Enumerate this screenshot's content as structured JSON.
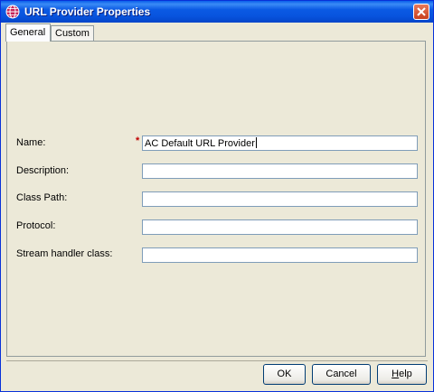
{
  "window": {
    "title": "URL Provider Properties",
    "icon": "globe-icon",
    "close_icon": "close-icon"
  },
  "tabs": [
    {
      "label": "General",
      "active": true
    },
    {
      "label": "Custom",
      "active": false
    }
  ],
  "form": {
    "name_label": "Name:",
    "name_required": "*",
    "name_value": "AC Default URL Provider",
    "description_label": "Description:",
    "description_value": "",
    "classpath_label": "Class Path:",
    "classpath_value": "",
    "protocol_label": "Protocol:",
    "protocol_value": "",
    "stream_label": "Stream handler class:",
    "stream_value": ""
  },
  "buttons": {
    "ok": "OK",
    "cancel": "Cancel",
    "help_first": "H",
    "help_rest": "elp"
  },
  "colors": {
    "titlebar": "#0854de",
    "required": "#c00000",
    "background": "#ece9d8"
  }
}
